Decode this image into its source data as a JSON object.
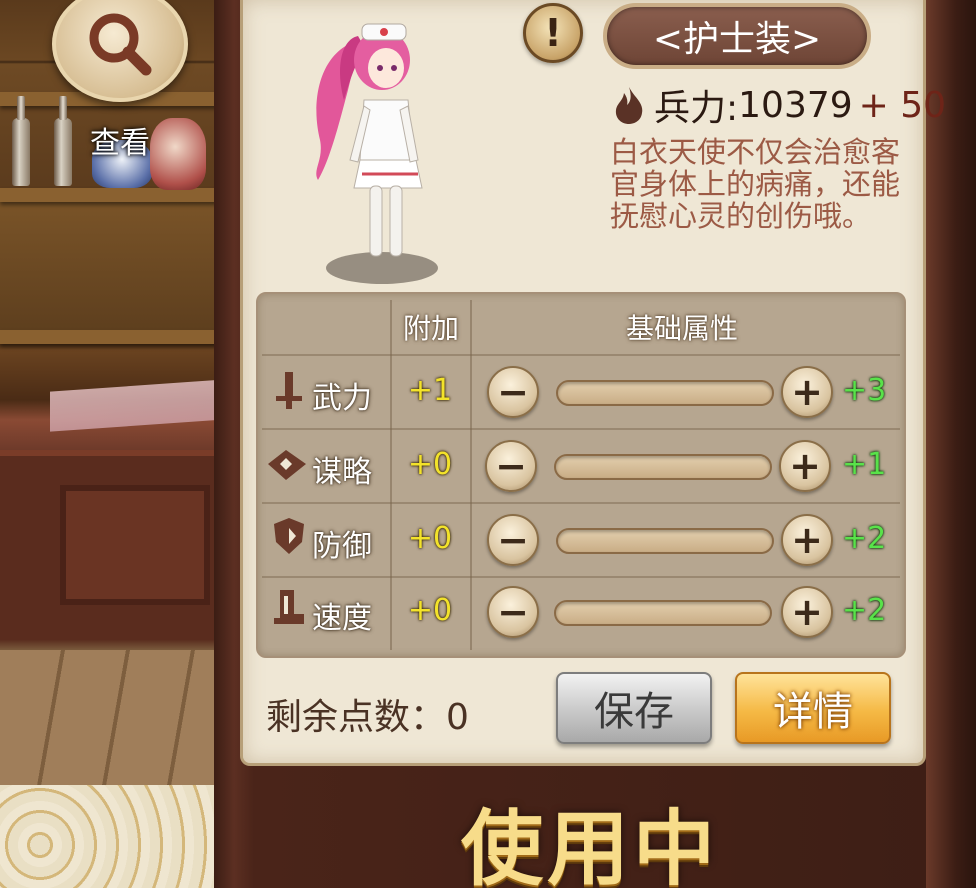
{
  "view_button": {
    "label": "查看"
  },
  "costume": {
    "name": "<护士装>",
    "power_label": "兵力:",
    "power_value": "10379",
    "power_bonus": "+ 50",
    "description": "白衣天使不仅会治愈客官身体上的病痛，还能抚慰心灵的创伤哦。"
  },
  "attributes": {
    "header_bonus": "附加",
    "header_base": "基础属性",
    "rows": [
      {
        "icon": "sword-icon",
        "label": "武力",
        "bonus": "+1",
        "base": "+3",
        "slider_value": 0
      },
      {
        "icon": "strategy-icon",
        "label": "谋略",
        "bonus": "+0",
        "base": "+1",
        "slider_value": 0
      },
      {
        "icon": "shield-icon",
        "label": "防御",
        "bonus": "+0",
        "base": "+2",
        "slider_value": 0
      },
      {
        "icon": "boot-icon",
        "label": "速度",
        "bonus": "+0",
        "base": "+2",
        "slider_value": 0
      }
    ],
    "minus_symbol": "−",
    "plus_symbol": "+"
  },
  "footer": {
    "remaining_label": "剩余点数：",
    "remaining_value": "0",
    "save_label": "保存",
    "detail_label": "详情"
  },
  "status": {
    "in_use": "使用中"
  },
  "colors": {
    "panel": "#efe7d5",
    "bonus_yellow": "#f3e32a",
    "base_green": "#59e24a",
    "detail_orange": "#f5b945",
    "name_plate": "#7a4e3e"
  }
}
